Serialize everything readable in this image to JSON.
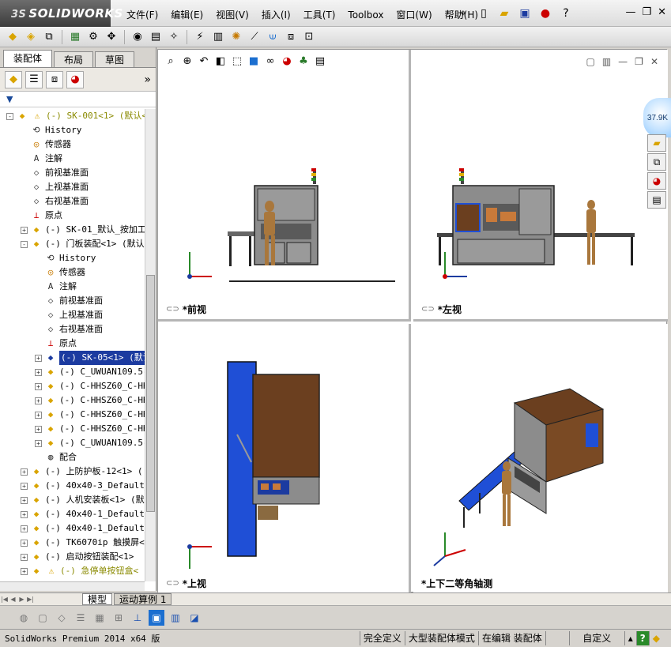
{
  "app": {
    "logo_text": "SOLIDWORKS",
    "logo_prefix": "3S"
  },
  "menu": [
    "文件(F)",
    "编辑(E)",
    "视图(V)",
    "插入(I)",
    "工具(T)",
    "Toolbox",
    "窗口(W)",
    "帮助(H)"
  ],
  "help_glyph": "?",
  "panel_tabs": [
    "装配体",
    "布局",
    "草图"
  ],
  "tree": [
    {
      "label": "(-) SK-001<1> (默认<",
      "warn": true,
      "level": 0,
      "exp": "-",
      "icon": "assembly-icon"
    },
    {
      "label": "History",
      "level": 1,
      "icon": "history-icon"
    },
    {
      "label": "传感器",
      "level": 1,
      "icon": "sensor-icon"
    },
    {
      "label": "注解",
      "level": 1,
      "icon": "annotation-icon"
    },
    {
      "label": "前视基准面",
      "level": 1,
      "icon": "plane-icon"
    },
    {
      "label": "上视基准面",
      "level": 1,
      "icon": "plane-icon"
    },
    {
      "label": "右视基准面",
      "level": 1,
      "icon": "plane-icon"
    },
    {
      "label": "原点",
      "level": 1,
      "icon": "origin-icon"
    },
    {
      "label": "(-) SK-01_默认_按加工",
      "level": 1,
      "exp": "+",
      "icon": "assembly-icon"
    },
    {
      "label": "(-) 门板装配<1> (默认",
      "level": 1,
      "exp": "-",
      "icon": "assembly-icon"
    },
    {
      "label": "History",
      "level": 2,
      "icon": "history-icon"
    },
    {
      "label": "传感器",
      "level": 2,
      "icon": "sensor-icon"
    },
    {
      "label": "注解",
      "level": 2,
      "icon": "annotation-icon"
    },
    {
      "label": "前视基准面",
      "level": 2,
      "icon": "plane-icon"
    },
    {
      "label": "上视基准面",
      "level": 2,
      "icon": "plane-icon"
    },
    {
      "label": "右视基准面",
      "level": 2,
      "icon": "plane-icon"
    },
    {
      "label": "原点",
      "level": 2,
      "icon": "origin-icon"
    },
    {
      "label": "(-) SK-05<1> (默认",
      "level": 2,
      "exp": "+",
      "icon": "part-icon",
      "selected": true
    },
    {
      "label": "(-) C_UWUAN109.5-",
      "level": 2,
      "exp": "+",
      "icon": "assembly-icon"
    },
    {
      "label": "(-) C-HHSZ60_C-HH",
      "level": 2,
      "exp": "+",
      "icon": "assembly-icon"
    },
    {
      "label": "(-) C-HHSZ60_C-HH",
      "level": 2,
      "exp": "+",
      "icon": "assembly-icon"
    },
    {
      "label": "(-) C-HHSZ60_C-HH",
      "level": 2,
      "exp": "+",
      "icon": "assembly-icon"
    },
    {
      "label": "(-) C-HHSZ60_C-HH",
      "level": 2,
      "exp": "+",
      "icon": "assembly-icon"
    },
    {
      "label": "(-) C_UWUAN109.5-",
      "level": 2,
      "exp": "+",
      "icon": "assembly-icon"
    },
    {
      "label": "配合",
      "level": 2,
      "icon": "mates-icon"
    },
    {
      "label": "(-) 上防护板-12<1> (",
      "level": 1,
      "exp": "+",
      "icon": "assembly-icon"
    },
    {
      "label": "(-) 40x40-3_Default_",
      "level": 1,
      "exp": "+",
      "icon": "assembly-icon"
    },
    {
      "label": "(-) 人机安装板<1> (默",
      "level": 1,
      "exp": "+",
      "icon": "assembly-icon"
    },
    {
      "label": "(-) 40x40-1_Default_",
      "level": 1,
      "exp": "+",
      "icon": "assembly-icon"
    },
    {
      "label": "(-) 40x40-1_Default_",
      "level": 1,
      "exp": "+",
      "icon": "assembly-icon"
    },
    {
      "label": "(-) TK6070ip 触摸屏<",
      "level": 1,
      "exp": "+",
      "icon": "assembly-icon"
    },
    {
      "label": "(-) 启动按钮装配<1>",
      "level": 1,
      "exp": "+",
      "icon": "assembly-icon"
    },
    {
      "label": "(-) 急停单按钮盒<",
      "level": 1,
      "exp": "+",
      "icon": "assembly-icon",
      "warn": true
    }
  ],
  "views": {
    "front": "*前视",
    "left": "*左视",
    "top": "*上视",
    "iso": "*上下二等角轴测"
  },
  "bottom_tabs": [
    "模型",
    "运动算例 1"
  ],
  "badge": "37.9K",
  "status": {
    "app": "SolidWorks Premium 2014 x64 版",
    "c1": "完全定义",
    "c2": "大型装配体模式",
    "c3": "在编辑 装配体",
    "c4": "自定义",
    "c5": "?"
  },
  "colors": {
    "selection": "#1c3ba0",
    "machine_body": "#8c8c8c",
    "cover": "#6b3f1f",
    "conveyor": "#1f4fd6"
  }
}
